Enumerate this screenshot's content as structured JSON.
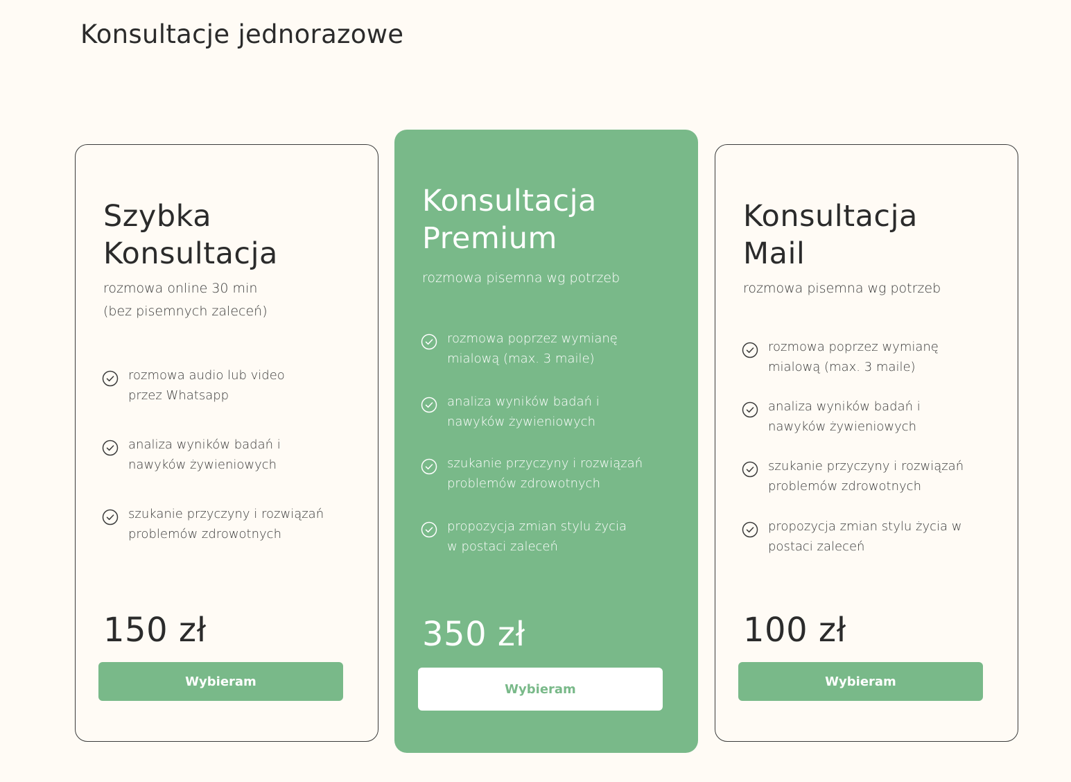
{
  "section": {
    "title": "Konsultacje jednorazowe"
  },
  "colors": {
    "background": "#fffbf5",
    "accent": "#79b989",
    "text": "#2b2b2b",
    "white": "#ffffff"
  },
  "plans": [
    {
      "title_line1": "Szybka",
      "title_line2": "Konsultacja",
      "subtitle_line1": "rozmowa online 30 min",
      "subtitle_line2": "(bez pisemnych zaleceń)",
      "features": [
        {
          "icon": "check-circle-icon",
          "line1": "rozmowa audio lub video",
          "line2": "przez Whatsapp"
        },
        {
          "icon": "check-circle-icon",
          "line1": "analiza wyników badań i",
          "line2": "nawyków żywieniowych"
        },
        {
          "icon": "check-circle-icon",
          "line1": "szukanie przyczyny i rozwiązań",
          "line2": "problemów zdrowotnych"
        }
      ],
      "price": "150 zł",
      "button_label": "Wybieram"
    },
    {
      "title_line1": "Konsultacja",
      "title_line2": "Premium",
      "subtitle_line1": "rozmowa pisemna wg potrzeb",
      "features": [
        {
          "icon": "check-circle-icon",
          "line1": "rozmowa poprzez wymianę",
          "line2": "mialową (max. 3 maile)"
        },
        {
          "icon": "check-circle-icon",
          "line1": "analiza wyników badań i",
          "line2": "nawyków żywieniowych"
        },
        {
          "icon": "check-circle-icon",
          "line1": "szukanie przyczyny i rozwiązań",
          "line2": "problemów zdrowotnych"
        },
        {
          "icon": "check-circle-icon",
          "line1": "propozycja zmian stylu życia",
          "line2": "w postaci zaleceń"
        }
      ],
      "price": "350 zł",
      "button_label": "Wybieram"
    },
    {
      "title_line1": "Konsultacja",
      "title_line2": "Mail",
      "subtitle_line1": "rozmowa pisemna wg potrzeb",
      "features": [
        {
          "icon": "check-circle-icon",
          "line1": "rozmowa poprzez wymianę",
          "line2": "mialową (max. 3 maile)"
        },
        {
          "icon": "check-circle-icon",
          "line1": "analiza wyników badań i",
          "line2": "nawyków żywieniowych"
        },
        {
          "icon": "check-circle-icon",
          "line1": "szukanie przyczyny i rozwiązań",
          "line2": "problemów zdrowotnych"
        },
        {
          "icon": "check-circle-icon",
          "line1": "propozycja zmian stylu życia w",
          "line2": "postaci zaleceń"
        }
      ],
      "price": "100 zł",
      "button_label": "Wybieram"
    }
  ]
}
